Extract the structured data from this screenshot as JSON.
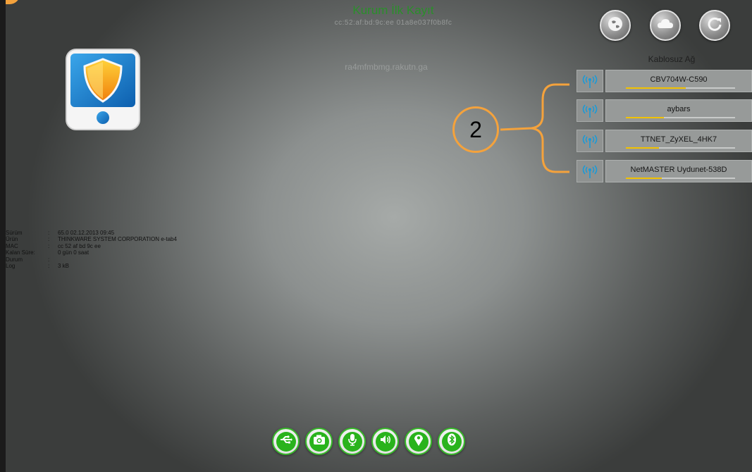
{
  "header": {
    "title": "Kurum İlk Kayıt",
    "subtitle": "cc:52:af:bd:9c:ee  01a8e037f0b8fc",
    "ghost_text": "ra4mfmbmg.rakutn.ga"
  },
  "top_buttons": [
    {
      "icon": "globe-icon"
    },
    {
      "icon": "cloud-icon"
    },
    {
      "icon": "refresh-icon"
    }
  ],
  "wifi": {
    "header": "Kablosuz Ağ",
    "networks": [
      {
        "name": "CBV704W-C590",
        "signal": 0.55
      },
      {
        "name": "aybars",
        "signal": 0.35
      },
      {
        "name": "TTNET_ZyXEL_4HK7",
        "signal": 0.3
      },
      {
        "name": "NetMASTER Uydunet-538D",
        "signal": 0.33
      }
    ]
  },
  "callout": {
    "number": "2",
    "color": "#f4a23c"
  },
  "device_info": [
    {
      "label": "Sürüm",
      "sep": ":",
      "value": "65.0  02.12.2013 09:45"
    },
    {
      "label": "Ürün",
      "sep": ":",
      "value": "THINKWARE SYSTEM CORPORATION e-tab4"
    },
    {
      "label": "MAC",
      "sep": ":",
      "value": "cc 52 af bd 9c ee"
    },
    {
      "label": "Kalan Süre:",
      "sep": "",
      "value": "0 gün 0 saat"
    },
    {
      "label": "Durum",
      "sep": ":",
      "value": ""
    },
    {
      "label": "Log",
      "sep": ":",
      "value": "3 kB"
    }
  ],
  "bottom_buttons": [
    {
      "icon": "usb-icon"
    },
    {
      "icon": "camera-icon"
    },
    {
      "icon": "microphone-icon"
    },
    {
      "icon": "speaker-icon"
    },
    {
      "icon": "location-icon"
    },
    {
      "icon": "bluetooth-icon"
    }
  ],
  "colors": {
    "accent_green": "#2a8f2a",
    "signal_yellow": "#f2c200",
    "callout_orange": "#f4a23c"
  }
}
